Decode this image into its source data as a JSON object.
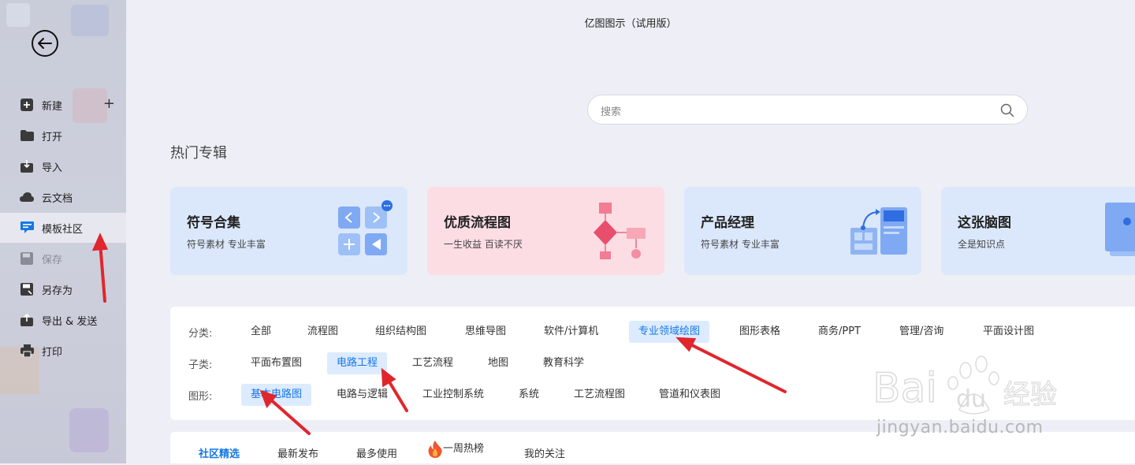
{
  "app": {
    "title": "亿图图示（试用版）"
  },
  "sidebar": {
    "items": [
      {
        "label": "新建",
        "icon": "plus-square-icon"
      },
      {
        "label": "打开",
        "icon": "folder-icon"
      },
      {
        "label": "导入",
        "icon": "import-icon"
      },
      {
        "label": "云文档",
        "icon": "cloud-icon"
      },
      {
        "label": "模板社区",
        "icon": "community-icon"
      },
      {
        "label": "保存",
        "icon": "save-icon"
      },
      {
        "label": "另存为",
        "icon": "save-as-icon"
      },
      {
        "label": "导出 & 发送",
        "icon": "export-icon"
      },
      {
        "label": "打印",
        "icon": "printer-icon"
      }
    ],
    "active_index": 4,
    "disabled_index": 5
  },
  "search": {
    "placeholder": "搜索"
  },
  "hot": {
    "title": "热门专辑"
  },
  "cards": [
    {
      "title": "符号合集",
      "subtitle": "符号素材 专业丰富",
      "bg": "#dbe8fb"
    },
    {
      "title": "优质流程图",
      "subtitle": "一生收益 百读不厌",
      "bg": "#fddde4"
    },
    {
      "title": "产品经理",
      "subtitle": "符号素材 专业丰富",
      "bg": "#dbe8fb"
    },
    {
      "title": "这张脑图",
      "subtitle": "全是知识点",
      "bg": "#dbe8fb"
    }
  ],
  "filters": {
    "category_label": "分类:",
    "categories": [
      "全部",
      "流程图",
      "组织结构图",
      "思维导图",
      "软件/计算机",
      "专业领域绘图",
      "图形表格",
      "商务/PPT",
      "管理/咨询",
      "平面设计图"
    ],
    "category_selected": 5,
    "sub_label": "子类:",
    "subs": [
      "平面布置图",
      "电路工程",
      "工艺流程",
      "地图",
      "教育科学"
    ],
    "sub_selected": 1,
    "shape_label": "图形:",
    "shapes": [
      "基本电路图",
      "电路与逻辑",
      "工业控制系统",
      "系统",
      "工艺流程图",
      "管道和仪表图"
    ],
    "shape_selected": 0
  },
  "tabs": [
    "社区精选",
    "最新发布",
    "最多使用",
    "一周热榜",
    "我的关注"
  ],
  "tab_active": 0,
  "watermark": {
    "text": "jingyan.baidu.com",
    "brand": "Bai du 经验"
  },
  "colors": {
    "accent": "#1677e6",
    "arrow": "#e0262d"
  }
}
